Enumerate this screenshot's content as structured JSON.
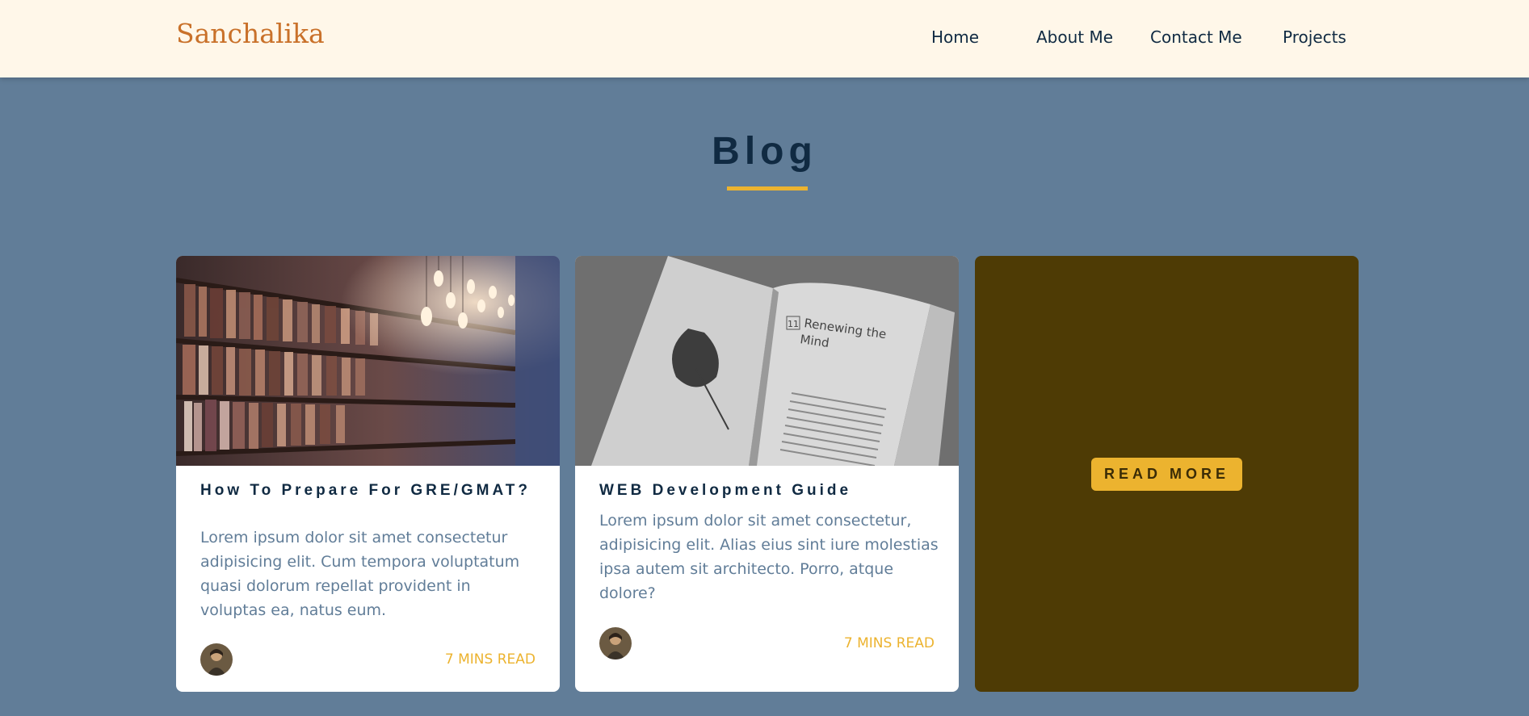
{
  "navbar": {
    "brand": "Sanchalika",
    "links": [
      "Home",
      "About Me",
      "Contact Me",
      "Projects"
    ]
  },
  "blog": {
    "title": "Blog",
    "cards": [
      {
        "image": "library-bookshelves-photo",
        "title": "How To Prepare For GRE/GMAT?",
        "text": "Lorem ipsum dolor sit amet consectetur adipisicing elit. Cum tempora voluptatum quasi dolorum repellat provident in voluptas ea, natus eum.",
        "read_time": "7 MINS READ",
        "avatar": "author-avatar"
      },
      {
        "image": "open-book-leaf-photo",
        "image_text": [
          "11",
          "Renewing the",
          "Mind"
        ],
        "title": "WEB Development Guide",
        "text": "Lorem ipsum dolor sit amet consectetur, adipisicing elit. Alias eius sint iure molestias ipsa autem sit architecto. Porro, atque dolore?",
        "read_time": "7 MINS READ",
        "avatar": "author-avatar"
      }
    ],
    "overlay_card": {
      "button_label": "READ MORE"
    }
  },
  "colors": {
    "page_bg": "#617d98",
    "navbar_bg": "#fff7e9",
    "brand": "#c9712a",
    "heading": "#102a42",
    "accent": "#ecb32f",
    "overlay": "#4e3b05"
  }
}
